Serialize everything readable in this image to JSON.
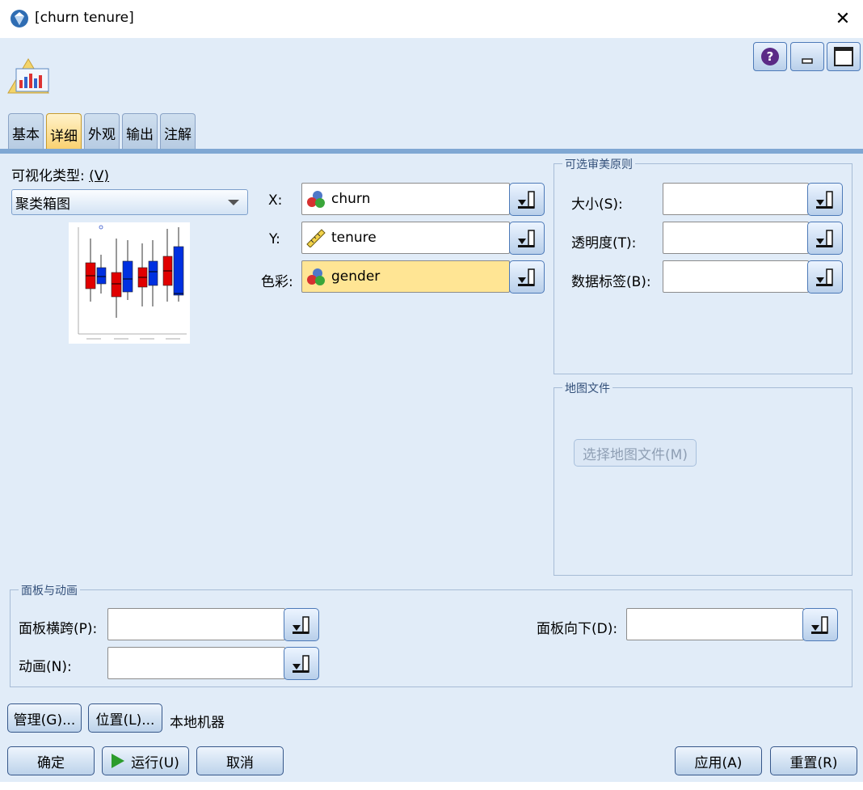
{
  "window": {
    "title": "[churn tenure]",
    "close_glyph": "✕"
  },
  "tabs": [
    {
      "label": "基本",
      "active": false
    },
    {
      "label": "详细",
      "active": true
    },
    {
      "label": "外观",
      "active": false
    },
    {
      "label": "输出",
      "active": false
    },
    {
      "label": "注解",
      "active": false
    }
  ],
  "viz_type": {
    "label": "可视化类型:",
    "hotkey": "(V)",
    "value": "聚类箱图"
  },
  "fields": {
    "x": {
      "label": "X:",
      "value": "churn",
      "icon": "nominal-icon"
    },
    "y": {
      "label": "Y:",
      "value": "tenure",
      "icon": "continuous-ruler-icon"
    },
    "color": {
      "label": "色彩:",
      "value": "gender",
      "icon": "nominal-icon"
    }
  },
  "optional": {
    "title": "可选审美原则",
    "size_label": "大小(S):",
    "size_value": "",
    "transparency_label": "透明度(T):",
    "transparency_value": "",
    "data_label_label": "数据标签(B):",
    "data_label_value": ""
  },
  "map_files": {
    "title": "地图文件",
    "button": "选择地图文件(M)"
  },
  "panel_anim": {
    "title": "面板与动画",
    "panel_across_label": "面板横跨(P):",
    "panel_across_value": "",
    "panel_down_label": "面板向下(D):",
    "panel_down_value": "",
    "animation_label": "动画(N):",
    "animation_value": ""
  },
  "server": {
    "manage": "管理(G)...",
    "location": "位置(L)...",
    "machine": "本地机器"
  },
  "actions": {
    "ok": "确定",
    "run": "运行(U)",
    "cancel": "取消",
    "apply": "应用(A)",
    "reset": "重置(R)"
  },
  "colors": {
    "accent": "#7fa7d3",
    "panel_bg": "#e1ecf8",
    "highlight": "#ffe594",
    "active_tab": "#f9cf6b"
  }
}
